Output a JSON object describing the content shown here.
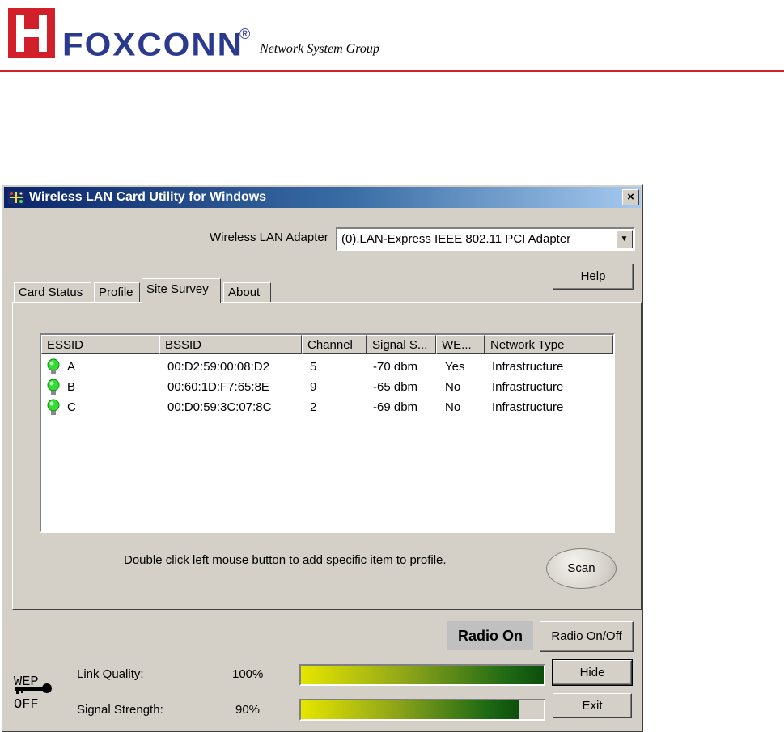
{
  "brand": {
    "name": "FOXCONN",
    "registered": "®",
    "group": "Network System Group",
    "colors": {
      "red": "#d2202a",
      "blue": "#2b3a8f"
    }
  },
  "window": {
    "title": "Wireless LAN Card Utility for Windows",
    "close_label": "×",
    "adapter_label": "Wireless LAN Adapter",
    "adapter_value": "(0).LAN-Express IEEE 802.11 PCI Adapter",
    "help_label": "Help",
    "tabs": [
      {
        "label": "Card Status",
        "active": false
      },
      {
        "label": "Profile",
        "active": false
      },
      {
        "label": "Site Survey",
        "active": true
      },
      {
        "label": "About",
        "active": false
      }
    ],
    "columns": [
      "ESSID",
      "BSSID",
      "Channel",
      "Signal S...",
      "WE...",
      "Network Type"
    ],
    "rows": [
      {
        "essid": "A",
        "bssid": "00:D2:59:00:08:D2",
        "channel": "5",
        "signal": "-70 dbm",
        "wep": "Yes",
        "type": "Infrastructure"
      },
      {
        "essid": "B",
        "bssid": "00:60:1D:F7:65:8E",
        "channel": "9",
        "signal": "-65 dbm",
        "wep": "No",
        "type": "Infrastructure"
      },
      {
        "essid": "C",
        "bssid": "00:D0:59:3C:07:8C",
        "channel": "2",
        "signal": "-69 dbm",
        "wep": "No",
        "type": "Infrastructure"
      }
    ],
    "hint": "Double click left mouse button to add specific item to profile.",
    "scan_label": "Scan",
    "radio_status": "Radio On",
    "radio_toggle_label": "Radio On/Off",
    "hide_label": "Hide",
    "exit_label": "Exit",
    "wep": {
      "line1": "WEP",
      "line2": "OFF"
    },
    "link_quality": {
      "label": "Link Quality:",
      "value": "100%",
      "level": 1.0
    },
    "signal_strength": {
      "label": "Signal Strength:",
      "value": "90%",
      "level": 0.9
    }
  }
}
